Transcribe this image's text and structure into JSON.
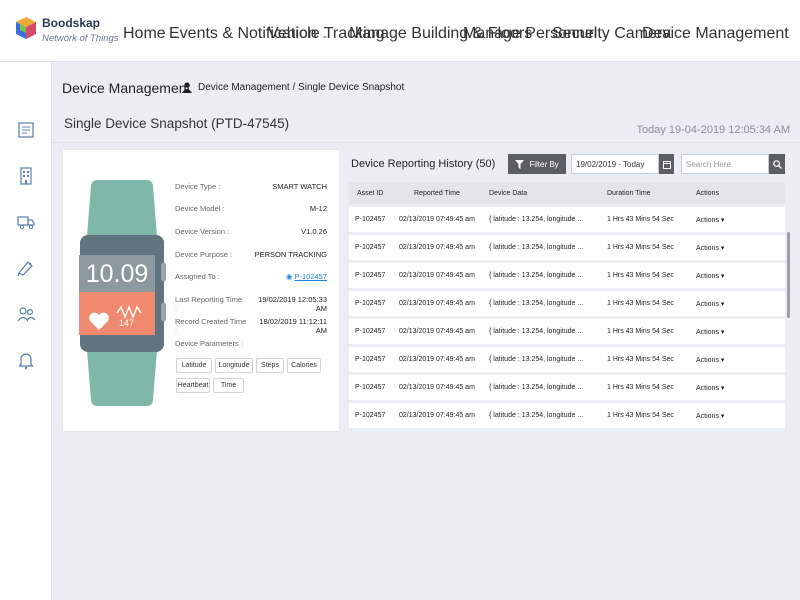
{
  "brand": {
    "name": "Boodskap",
    "tagline": "Network of Things"
  },
  "nav": [
    {
      "label": "Home"
    },
    {
      "label": "Events & Notification"
    },
    {
      "label": "Vehicle Tracking"
    },
    {
      "label": "Manage Building & Floors"
    },
    {
      "label": "Manage Personnel"
    },
    {
      "label": "Security Camera"
    },
    {
      "label": "Device Management"
    }
  ],
  "sidebar": [
    {
      "icon": "dashboard-icon"
    },
    {
      "icon": "building-icon"
    },
    {
      "icon": "truck-icon"
    },
    {
      "icon": "camera-icon"
    },
    {
      "icon": "people-icon"
    },
    {
      "icon": "bell-icon"
    }
  ],
  "header": {
    "title": "Device Management",
    "breadcrumb": "Device Management /  Single Device Snapshot"
  },
  "snapshot": {
    "title": "Single Device Snapshot  (PTD-47545)",
    "today_label": "Today",
    "datetime": "19-04-2019 12:05:34 AM"
  },
  "watch": {
    "time": "10.09",
    "heart_value": "147"
  },
  "device": {
    "rows": [
      {
        "label": "Device Type :",
        "value": "SMART WATCH"
      },
      {
        "label": "Device Model :",
        "value": "M-12"
      },
      {
        "label": "Device Version :",
        "value": "V1.0.26"
      },
      {
        "label": "Device Purpose :",
        "value": "PERSON TRACKING"
      },
      {
        "label": "Assigned To :",
        "value": "P-102457"
      },
      {
        "label": "Last Reporting Time :",
        "value": "19/02/2019 12:05:33 AM"
      },
      {
        "label": "Record Created Time :",
        "value": "18/02/2019 11:12:11 AM"
      }
    ],
    "params_label": "Device Parameters :",
    "params": [
      "Latitude",
      "Longitude",
      "Steps",
      "Calories",
      "Heartbeat",
      "Time"
    ]
  },
  "history": {
    "title": "Device Reporting History (50)",
    "filter_label": "Filter By",
    "date_value": "19/02/2019 - Today",
    "search_placeholder": "Search Here",
    "columns": [
      "Asset ID",
      "Reported Time",
      "Device Data",
      "Duration Time",
      "Actions"
    ],
    "rows": [
      [
        "P-102457",
        "02/13/2019 07:49:45 am",
        "{ latitude : 13.254, longitude ...",
        "1 Hrs 43 Mins 54 Sec",
        "Actions"
      ],
      [
        "P-102457",
        "02/13/2019 07:49:45 am",
        "{ latitude : 13.254, longitude ...",
        "1 Hrs 43 Mins 54 Sec",
        "Actions"
      ],
      [
        "P-102457",
        "02/13/2019 07:49:45 am",
        "{ latitude : 13.254, longitude ...",
        "1 Hrs 43 Mins 54 Sec",
        "Actions"
      ],
      [
        "P-102457",
        "02/13/2019 07:49:45 am",
        "{ latitude : 13.254, longitude ...",
        "1 Hrs 43 Mins 54 Sec",
        "Actions"
      ],
      [
        "P-102457",
        "02/13/2019 07:49:45 am",
        "{ latitude : 13.254, longitude ...",
        "1 Hrs 43 Mins 54 Sec",
        "Actions"
      ],
      [
        "P-102457",
        "02/13/2019 07:49:45 am",
        "{ latitude : 13.254, longitude ...",
        "1 Hrs 43 Mins 54 Sec",
        "Actions"
      ],
      [
        "P-102457",
        "02/13/2019 07:49:45 am",
        "{ latitude : 13.254, longitude ...",
        "1 Hrs 43 Mins 54 Sec",
        "Actions"
      ],
      [
        "P-102457",
        "02/13/2019 07:49:45 am",
        "{ latitude : 13.254, longitude ...",
        "1 Hrs 43 Mins 54 Sec",
        "Actions"
      ]
    ]
  },
  "colors": {
    "accent": "#5a5f66",
    "watch_band": "#7fb8a8",
    "watch_screen": "#f08a6e",
    "link": "#1e88e5"
  }
}
